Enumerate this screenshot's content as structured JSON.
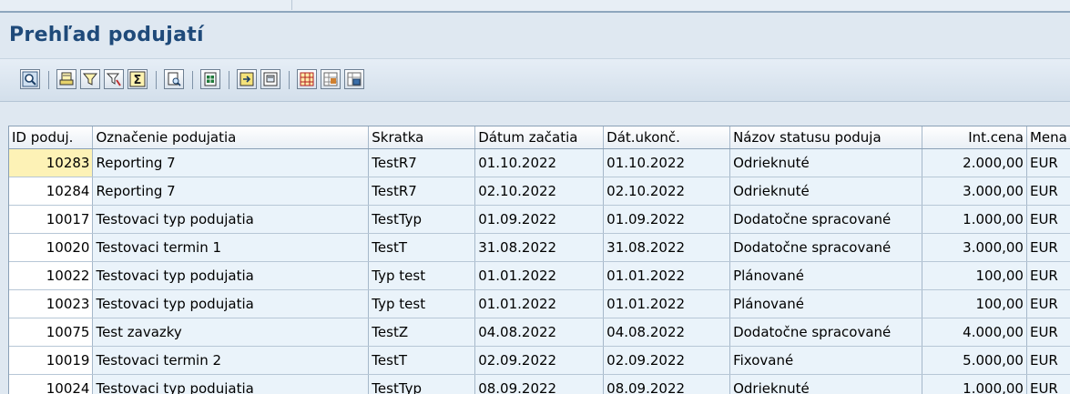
{
  "page": {
    "title": "Prehľad podujatí"
  },
  "toolbar": {
    "buttons": [
      {
        "icon": "details-magnifier-icon"
      },
      {
        "icon": "sort-ascending-icon"
      },
      {
        "icon": "sort-descending-icon"
      },
      {
        "icon": "filter-icon"
      },
      {
        "icon": "sum-icon"
      },
      {
        "icon": "print-preview-icon"
      },
      {
        "icon": "export-spreadsheet-icon"
      },
      {
        "icon": "local-file-icon"
      },
      {
        "icon": "word-processing-icon"
      },
      {
        "icon": "change-layout-icon"
      },
      {
        "icon": "select-layout-icon"
      },
      {
        "icon": "save-layout-icon"
      }
    ]
  },
  "table": {
    "columns": [
      "ID poduj.",
      "Označenie podujatia",
      "Skratka",
      "Dátum začatia",
      "Dát.ukonč.",
      "Názov statusu poduja",
      "Int.cena",
      "Mena"
    ],
    "rows": [
      [
        "10283",
        "Reporting 7",
        "TestR7",
        "01.10.2022",
        "01.10.2022",
        "Odrieknuté",
        "2.000,00",
        "EUR"
      ],
      [
        "10284",
        "Reporting 7",
        "TestR7",
        "02.10.2022",
        "02.10.2022",
        "Odrieknuté",
        "3.000,00",
        "EUR"
      ],
      [
        "10017",
        "Testovaci typ podujatia",
        "TestTyp",
        "01.09.2022",
        "01.09.2022",
        "Dodatočne spracované",
        "1.000,00",
        "EUR"
      ],
      [
        "10020",
        "Testovaci termin 1",
        "TestT",
        "31.08.2022",
        "31.08.2022",
        "Dodatočne spracované",
        "3.000,00",
        "EUR"
      ],
      [
        "10022",
        "Testovaci typ podujatia",
        "Typ test",
        "01.01.2022",
        "01.01.2022",
        "Plánované",
        "100,00",
        "EUR"
      ],
      [
        "10023",
        "Testovaci typ podujatia",
        "Typ test",
        "01.01.2022",
        "01.01.2022",
        "Plánované",
        "100,00",
        "EUR"
      ],
      [
        "10075",
        "Test zavazky",
        "TestZ",
        "04.08.2022",
        "04.08.2022",
        "Dodatočne spracované",
        "4.000,00",
        "EUR"
      ],
      [
        "10019",
        "Testovaci termin 2",
        "TestT",
        "02.09.2022",
        "02.09.2022",
        "Fixované",
        "5.000,00",
        "EUR"
      ],
      [
        "10024",
        "Testovaci typ podujatia",
        "TestTyp",
        "08.09.2022",
        "08.09.2022",
        "Odrieknuté",
        "1.000,00",
        "EUR"
      ]
    ]
  }
}
